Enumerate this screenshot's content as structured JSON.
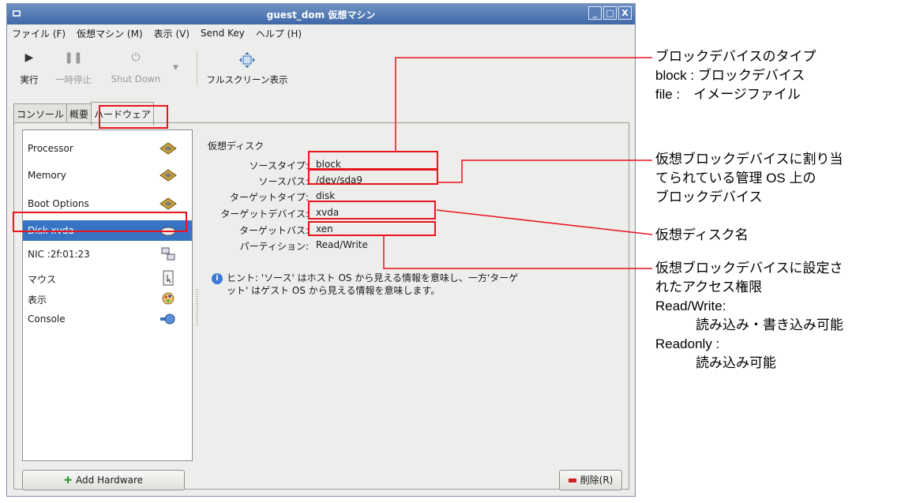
{
  "window": {
    "title": "guest_dom 仮想マシン",
    "controls": [
      "_",
      "□",
      "X"
    ]
  },
  "menu": [
    "ファイル (F)",
    "仮想マシン (M)",
    "表示 (V)",
    "Send Key",
    "ヘルプ (H)"
  ],
  "toolbar": {
    "run": "実行",
    "pause": "一時停止",
    "shutdown": "Shut Down",
    "fullscreen": "フルスクリーン表示"
  },
  "tabs": [
    "コンソール",
    "概要",
    "ハードウェア"
  ],
  "devices": [
    {
      "label": "Processor",
      "icon": "chip-icon"
    },
    {
      "label": "Memory",
      "icon": "chip-icon"
    },
    {
      "label": "Boot Options",
      "icon": "chip-icon"
    },
    {
      "label": "Disk xvda",
      "icon": "disk-icon",
      "selected": true
    },
    {
      "label": "NIC :2f:01:23",
      "icon": "network-icon"
    },
    {
      "label": "マウス",
      "icon": "mouse-icon"
    },
    {
      "label": "表示",
      "icon": "display-icon"
    },
    {
      "label": "Console",
      "icon": "console-icon"
    }
  ],
  "detail": {
    "title": "仮想ディスク",
    "rows": [
      {
        "key": "ソースタイプ:",
        "value": "block"
      },
      {
        "key": "ソースパス:",
        "value": "/dev/sda9"
      },
      {
        "key": "ターゲットタイプ:",
        "value": "disk"
      },
      {
        "key": "ターゲットデバイス:",
        "value": "xvda"
      },
      {
        "key": "ターゲットバス:",
        "value": "xen"
      },
      {
        "key": "パーティション:",
        "value": "Read/Write"
      }
    ],
    "hint": "ヒント: 'ソース' はホスト OS から見える情報を意味し、一方'ターゲット' はゲスト OS から見える情報を意味します。"
  },
  "buttons": {
    "add_hardware": "Add Hardware",
    "delete": "削除(R)"
  },
  "annotations": [
    {
      "lines": [
        "ブロックデバイスのタイプ",
        "block : ブロックデバイス",
        "file :　イメージファイル"
      ]
    },
    {
      "lines": [
        "仮想ブロックデバイスに割り当",
        "てられている管理 OS 上の",
        "ブロックデバイス"
      ]
    },
    {
      "lines": [
        "仮想ディスク名"
      ]
    },
    {
      "lines": [
        "仮想ブロックデバイスに設定さ",
        "れたアクセス権限",
        "Read/Write:",
        "　　　読み込み・書き込み可能",
        "Readonly :",
        "　　　読み込み可能"
      ]
    }
  ],
  "colors": {
    "highlight": "#e8141e",
    "selection": "#3874c4",
    "titlebar": "#4a72b0"
  }
}
